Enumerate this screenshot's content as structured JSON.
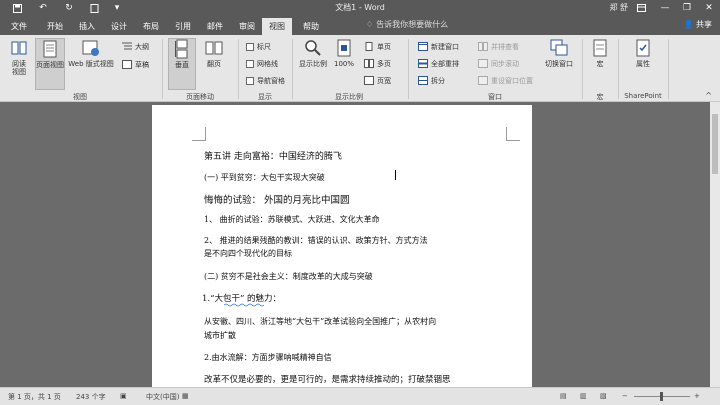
{
  "titlebar": {
    "title": "文档1 - Word",
    "user": "郑 舒",
    "quick_access": [
      "save-icon",
      "undo-icon",
      "redo-icon",
      "print-preview-icon",
      "customize-icon"
    ]
  },
  "tabs": [
    "文件",
    "开始",
    "插入",
    "设计",
    "布局",
    "引用",
    "邮件",
    "审阅",
    "视图",
    "帮助"
  ],
  "active_tab": "视图",
  "search_placeholder": "告诉我你想要做什么",
  "share_label": "共享",
  "ribbon": {
    "views": {
      "read_mode": "阅读\n视图",
      "print_layout": "页面视图",
      "web_layout": "Web 版式视图",
      "outline": "大纲",
      "draft": "草稿",
      "group_label": "视图"
    },
    "page_movement": {
      "vertical": "垂直",
      "side_to_side": "翻页",
      "group_label": "页面移动"
    },
    "show": {
      "ruler": "标尺",
      "gridlines": "网格线",
      "nav_pane": "导航窗格",
      "group_label": "显示"
    },
    "zoom": {
      "zoom": "显示比例",
      "hundred": "100%",
      "one_page": "单页",
      "multi_page": "多页",
      "page_width": "页宽",
      "group_label": "显示比例"
    },
    "window": {
      "new_window": "新建窗口",
      "arrange_all": "全部重排",
      "split": "拆分",
      "side_by_side": "并排查看",
      "sync_scroll": "同步滚动",
      "reset_position": "重设窗口位置",
      "switch_windows": "切换窗口",
      "group_label": "窗口"
    },
    "macros": {
      "label": "宏",
      "group_label": "宏"
    },
    "sharepoint": {
      "properties": "属性",
      "group_label": "SharePoint"
    }
  },
  "document": {
    "lines": [
      "第五讲  走向富裕：中国经济的腾飞",
      "(一) 平到贫穷：大包干实现大突破",
      "悔悔的试验：  外国的月亮比中国圆",
      "1、     曲折的试验：苏联模式、大跃进、文化大革命",
      "2、     推进的结果残酷的教训：错误的认识、政策方针、方式方法",
      "是不向四个现代化的目标",
      "(二) 贫穷不是社会主义：制度改革的大成与突破",
      "1.“大包干” 的魅力：",
      "从安徽、四川、浙江等地“大包干”改革试验向全国推广；从农村向",
      "城市扩散",
      "2.由水流解：方面步骤呐喊精神自信",
      "改革不仅是必要的，更是可行的，是需求持续推动的；打破禁锢思"
    ]
  },
  "statusbar": {
    "page": "第 1 页，共 1 页",
    "words": "243 个字",
    "language": "中文(中国)"
  }
}
